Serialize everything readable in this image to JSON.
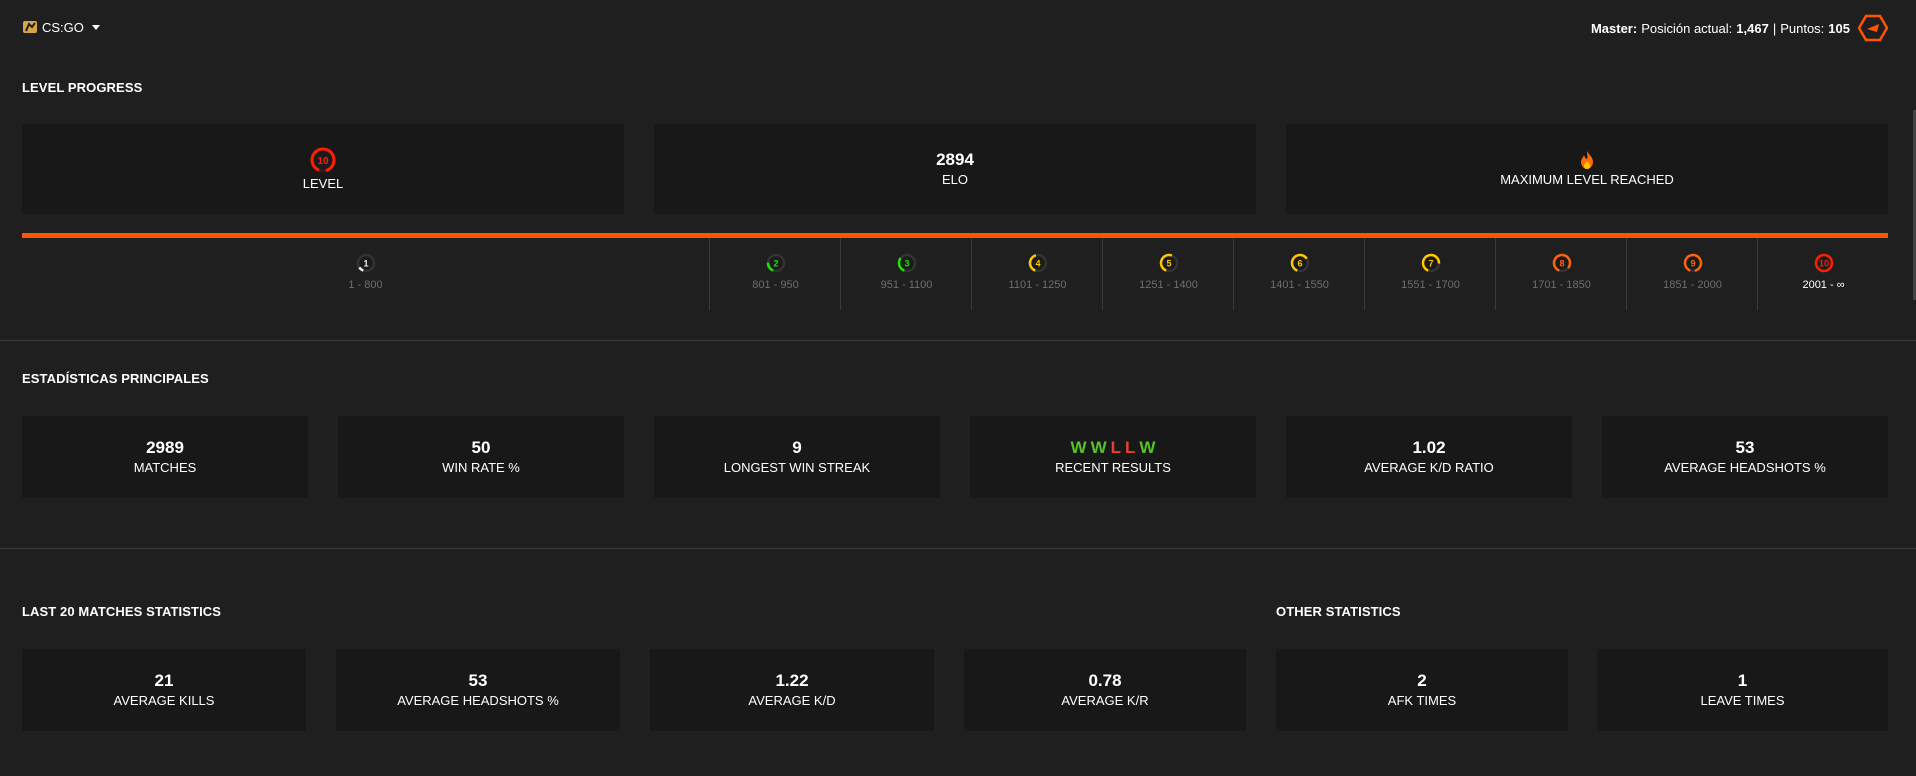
{
  "header": {
    "game": "CS:GO",
    "ranking": {
      "tier": "Master:",
      "position_label": "Posición actual:",
      "position": "1,467",
      "separator": "|",
      "points_label": "Puntos:",
      "points": "105"
    }
  },
  "level_progress": {
    "title": "LEVEL PROGRESS",
    "cards": [
      {
        "value": "10",
        "label": "LEVEL"
      },
      {
        "value": "2894",
        "label": "ELO"
      },
      {
        "icon": "flame-icon",
        "label": "MAXIMUM LEVEL REACHED"
      }
    ],
    "progress": 1.0,
    "levels": [
      {
        "level": "1",
        "range": "1 - 800",
        "color": "#eeeeee",
        "fill": 0.1
      },
      {
        "level": "2",
        "range": "801 - 950",
        "color": "#1ce400",
        "fill": 0.2
      },
      {
        "level": "3",
        "range": "951 - 1100",
        "color": "#1ce400",
        "fill": 0.3
      },
      {
        "level": "4",
        "range": "1101 - 1250",
        "color": "#ffc800",
        "fill": 0.4
      },
      {
        "level": "5",
        "range": "1251 - 1400",
        "color": "#ffc800",
        "fill": 0.5
      },
      {
        "level": "6",
        "range": "1401 - 1550",
        "color": "#ffc800",
        "fill": 0.6
      },
      {
        "level": "7",
        "range": "1551 - 1700",
        "color": "#ffc800",
        "fill": 0.7
      },
      {
        "level": "8",
        "range": "1701 - 1850",
        "color": "#ff6309",
        "fill": 0.8
      },
      {
        "level": "9",
        "range": "1851 - 2000",
        "color": "#ff6309",
        "fill": 0.9
      },
      {
        "level": "10",
        "range": "2001 - ∞",
        "color": "#fe1f00",
        "fill": 1.0
      }
    ]
  },
  "main_stats": {
    "title": "ESTADÍSTICAS PRINCIPALES",
    "cards": [
      {
        "value": "2989",
        "label": "MATCHES"
      },
      {
        "value": "50",
        "label": "WIN RATE %"
      },
      {
        "value": "9",
        "label": "LONGEST WIN STREAK"
      },
      {
        "results": [
          "W",
          "W",
          "L",
          "L",
          "W"
        ],
        "label": "RECENT RESULTS"
      },
      {
        "value": "1.02",
        "label": "AVERAGE K/D RATIO"
      },
      {
        "value": "53",
        "label": "AVERAGE HEADSHOTS %"
      }
    ]
  },
  "last20": {
    "title": "LAST 20 MATCHES STATISTICS",
    "cards": [
      {
        "value": "21",
        "label": "AVERAGE KILLS"
      },
      {
        "value": "53",
        "label": "AVERAGE HEADSHOTS %"
      },
      {
        "value": "1.22",
        "label": "AVERAGE K/D"
      },
      {
        "value": "0.78",
        "label": "AVERAGE K/R"
      }
    ]
  },
  "other": {
    "title": "OTHER STATISTICS",
    "cards": [
      {
        "value": "2",
        "label": "AFK TIMES"
      },
      {
        "value": "1",
        "label": "LEAVE TIMES"
      }
    ]
  },
  "colors": {
    "accent": "#ff5500",
    "win": "#56c22b",
    "loss": "#e44133",
    "card": "#181818",
    "background": "#1f1f1f"
  }
}
